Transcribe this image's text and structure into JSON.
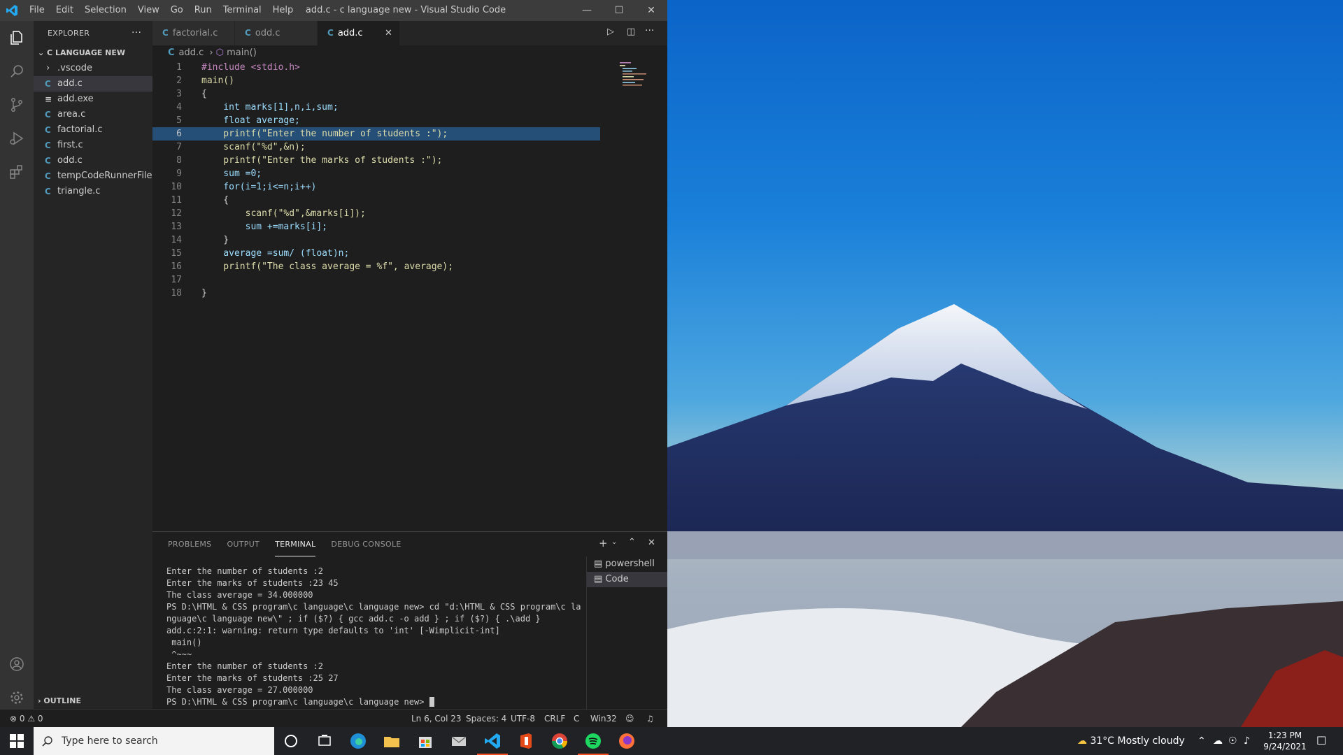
{
  "window": {
    "title": "add.c - c language new - Visual Studio Code",
    "menu": [
      "File",
      "Edit",
      "Selection",
      "View",
      "Go",
      "Run",
      "Terminal",
      "Help"
    ]
  },
  "explorer": {
    "header": "EXPLORER",
    "folder": "C LANGUAGE NEW",
    "items": [
      ".vscode",
      "add.c",
      "add.exe",
      "area.c",
      "factorial.c",
      "first.c",
      "odd.c",
      "tempCodeRunnerFile.c",
      "triangle.c"
    ],
    "outline": "OUTLINE"
  },
  "tabs": [
    "factorial.c",
    "odd.c",
    "add.c"
  ],
  "breadcrumb": {
    "file": "add.c",
    "symbol": "main()"
  },
  "code": {
    "lines": [
      "#include <stdio.h>",
      "main()",
      "{",
      "    int marks[1],n,i,sum;",
      "    float average;",
      "    printf(\"Enter the number of students :\");",
      "    scanf(\"%d\",&n);",
      "    printf(\"Enter the marks of students :\");",
      "    sum =0;",
      "    for(i=1;i<=n;i++)",
      "    {",
      "        scanf(\"%d\",&marks[i]);",
      "        sum +=marks[i];",
      "    }",
      "    average =sum/ (float)n;",
      "    printf(\"The class average = %f\", average);",
      "",
      "}"
    ],
    "current_line": 6
  },
  "panel": {
    "tabs": [
      "PROBLEMS",
      "OUTPUT",
      "TERMINAL",
      "DEBUG CONSOLE"
    ],
    "terminal_lines": [
      "Enter the number of students :2",
      "Enter the marks of students :23 45",
      "The class average = 34.000000",
      "PS D:\\HTML & CSS program\\c language\\c language new> cd \"d:\\HTML & CSS program\\c la",
      "nguage\\c language new\\\" ; if ($?) { gcc add.c -o add } ; if ($?) { .\\add }",
      "add.c:2:1: warning: return type defaults to 'int' [-Wimplicit-int]",
      " main()",
      " ^~~~",
      "Enter the number of students :2",
      "Enter the marks of students :25 27",
      "The class average = 27.000000",
      "PS D:\\HTML & CSS program\\c language\\c language new> "
    ],
    "shells": [
      "powershell",
      "Code"
    ]
  },
  "status": {
    "problems": "0",
    "warnings": "0",
    "position": "Ln 6, Col 23",
    "spaces": "Spaces: 4",
    "encoding": "UTF-8",
    "eol": "CRLF",
    "language": "C",
    "platform": "Win32"
  },
  "taskbar": {
    "search_placeholder": "Type here to search",
    "weather": "31°C  Mostly cloudy",
    "time": "1:23 PM",
    "date": "9/24/2021"
  },
  "colors": {
    "accent": "#007acc",
    "terminal_prompt": "#e5e510",
    "selection": "#264f78"
  }
}
